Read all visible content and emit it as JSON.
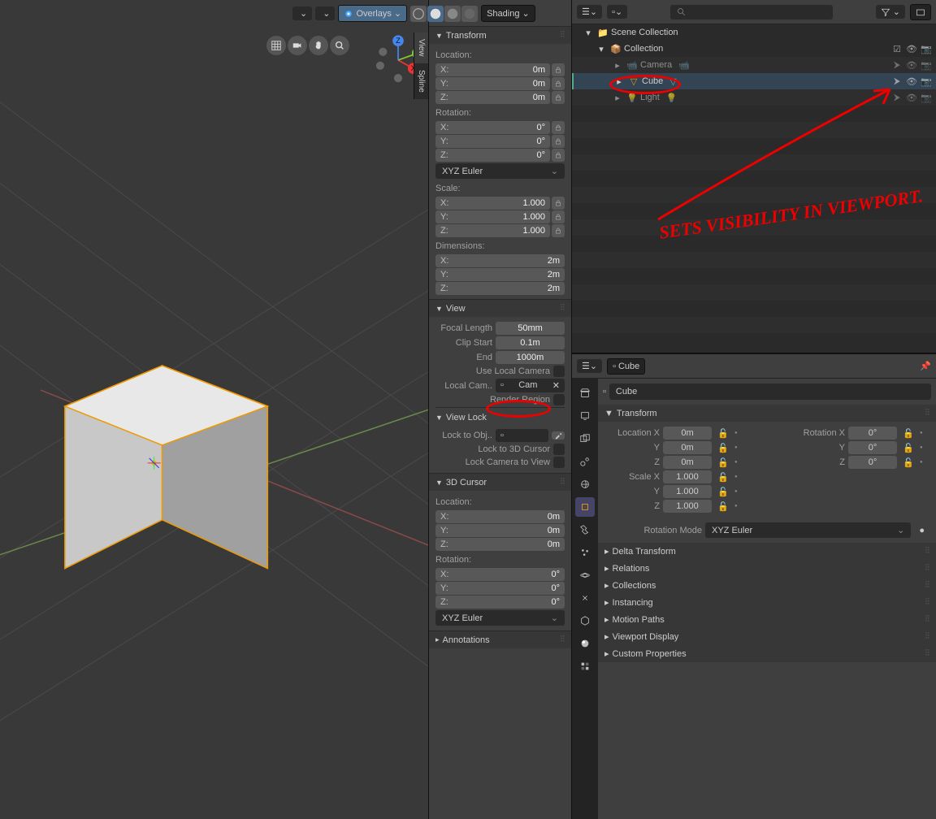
{
  "header": {
    "overlays": "Overlays",
    "shading": "Shading"
  },
  "npanel": {
    "tabs": [
      "View",
      "Spline"
    ],
    "transform": {
      "title": "Transform",
      "location_label": "Location:",
      "loc": [
        {
          "k": "X:",
          "v": "0m"
        },
        {
          "k": "Y:",
          "v": "0m"
        },
        {
          "k": "Z:",
          "v": "0m"
        }
      ],
      "rotation_label": "Rotation:",
      "rot": [
        {
          "k": "X:",
          "v": "0°"
        },
        {
          "k": "Y:",
          "v": "0°"
        },
        {
          "k": "Z:",
          "v": "0°"
        }
      ],
      "rotmode": "XYZ Euler",
      "scale_label": "Scale:",
      "scale": [
        {
          "k": "X:",
          "v": "1.000"
        },
        {
          "k": "Y:",
          "v": "1.000"
        },
        {
          "k": "Z:",
          "v": "1.000"
        }
      ],
      "dim_label": "Dimensions:",
      "dim": [
        {
          "k": "X:",
          "v": "2m"
        },
        {
          "k": "Y:",
          "v": "2m"
        },
        {
          "k": "Z:",
          "v": "2m"
        }
      ]
    },
    "view": {
      "title": "View",
      "focal_lbl": "Focal Length",
      "focal_val": "50mm",
      "clip_start_lbl": "Clip Start",
      "clip_start_val": "0.1m",
      "clip_end_lbl": "End",
      "clip_end_val": "1000m",
      "local_cam_lbl": "Use Local Camera",
      "local_cam_row_lbl": "Local Cam..",
      "local_cam_val": "Cam",
      "render_region_lbl": "Render Region",
      "viewlock_title": "View Lock",
      "lock_obj_lbl": "Lock to Obj..",
      "lock_cursor_lbl": "Lock to 3D Cursor",
      "lock_camview_lbl": "Lock Camera to View"
    },
    "cursor": {
      "title": "3D Cursor",
      "location_label": "Location:",
      "loc": [
        {
          "k": "X:",
          "v": "0m"
        },
        {
          "k": "Y:",
          "v": "0m"
        },
        {
          "k": "Z:",
          "v": "0m"
        }
      ],
      "rotation_label": "Rotation:",
      "rot": [
        {
          "k": "X:",
          "v": "0°"
        },
        {
          "k": "Y:",
          "v": "0°"
        },
        {
          "k": "Z:",
          "v": "0°"
        }
      ],
      "rotmode": "XYZ Euler"
    },
    "annotations": {
      "title": "Annotations"
    }
  },
  "outliner": {
    "scene_collection": "Scene Collection",
    "collection": "Collection",
    "items": [
      {
        "name": "Camera",
        "type": "camera"
      },
      {
        "name": "Cube",
        "type": "mesh",
        "selected": true
      },
      {
        "name": "Light",
        "type": "light"
      }
    ]
  },
  "props": {
    "name": "Cube",
    "transform_title": "Transform",
    "loc": {
      "lbl": "Location X",
      "x": "0m",
      "y": "0m",
      "z": "0m"
    },
    "rot": {
      "lbl": "Rotation X",
      "x": "0°",
      "y": "0°",
      "z": "0°"
    },
    "scl": {
      "lbl": "Scale X",
      "x": "1.000",
      "y": "1.000",
      "z": "1.000"
    },
    "rotmode_lbl": "Rotation Mode",
    "rotmode_val": "XYZ Euler",
    "sections": [
      "Delta Transform",
      "Relations",
      "Collections",
      "Instancing",
      "Motion Paths",
      "Viewport Display",
      "Custom Properties"
    ]
  },
  "annotation_text": "SETS VISIBILITY IN VIEWPORT."
}
